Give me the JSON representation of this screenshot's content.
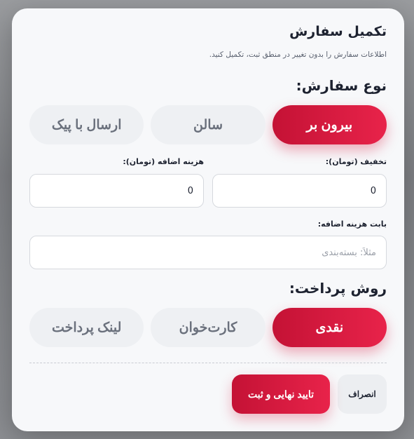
{
  "modal": {
    "title": "تکمیل سفارش",
    "subtitle": "اطلاعات سفارش را بدون تغییر در منطق ثبت، تکمیل کنید."
  },
  "order_type": {
    "title": "نوع سفارش:",
    "options": [
      "بیرون بر",
      "سالن",
      "ارسال با پیک"
    ],
    "selected": "بیرون بر"
  },
  "fields": {
    "discount_label": "تخفیف (تومان):",
    "discount_value": "0",
    "extra_cost_label": "هزینه اضافه (تومان):",
    "extra_cost_value": "0",
    "extra_reason_label": "بابت هزینه اضافه:",
    "extra_reason_placeholder": "مثلاً: بسته‌بندی"
  },
  "payment": {
    "title": "روش پرداخت:",
    "options": [
      "نقدی",
      "کارت‌خوان",
      "لینک پرداخت"
    ],
    "selected": "نقدی"
  },
  "actions": {
    "cancel_label": "انصراف",
    "confirm_label": "تایید نهایی و ثبت"
  },
  "colors": {
    "accent": "#e0193f",
    "inactive": "#eef0f3"
  }
}
